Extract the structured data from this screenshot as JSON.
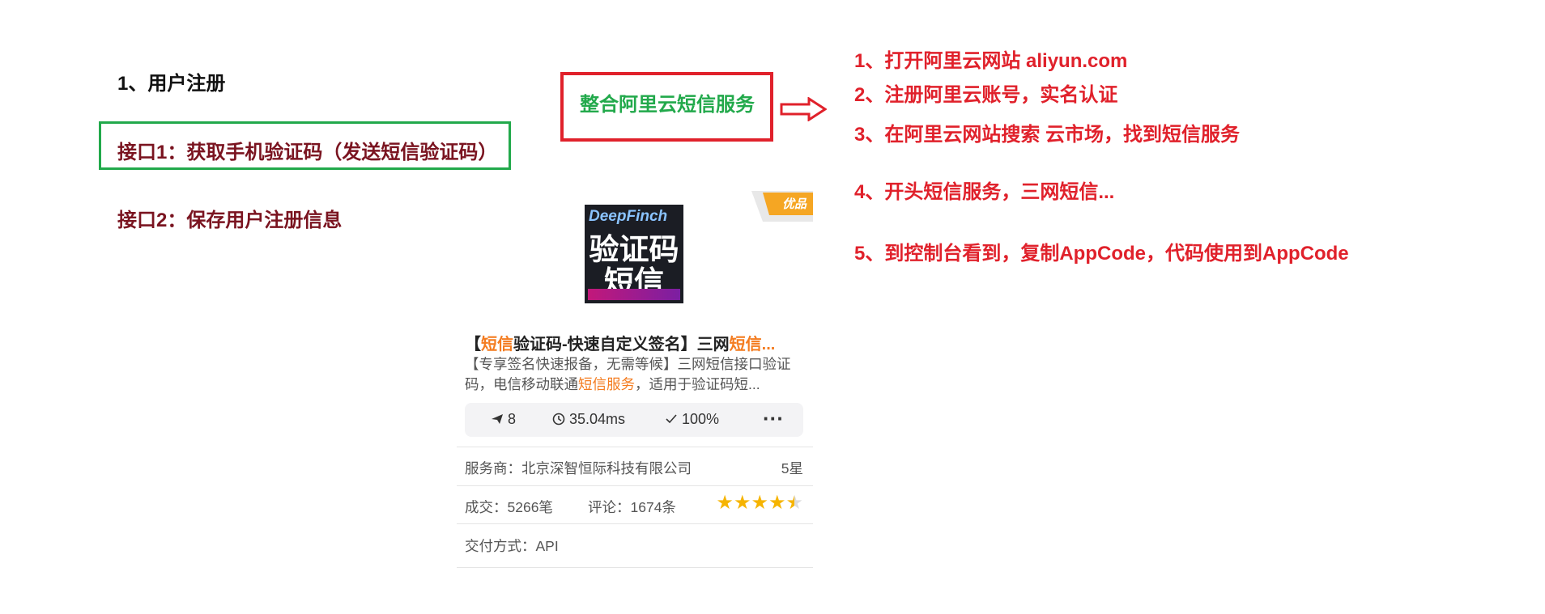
{
  "left": {
    "section_title": "1、用户注册",
    "api1": "接口1：获取手机验证码（发送短信验证码）",
    "api2": "接口2：保存用户注册信息"
  },
  "center": {
    "box_title": "整合阿里云短信服务"
  },
  "steps": [
    "1、打开阿里云网站 aliyun.com",
    "2、注册阿里云账号，实名认证",
    "3、在阿里云网站搜索 云市场，找到短信服务",
    "4、开头短信服务，三网短信...",
    "5、到控制台看到，复制AppCode，代码使用到AppCode"
  ],
  "product": {
    "badge": "优品",
    "thumb_logo": "DeepFinch",
    "thumb_line1": "验证码",
    "thumb_line2": "短信",
    "title_part1": "【",
    "title_highlight": "短信",
    "title_part2": "验证码-快速自定义签名】三网",
    "title_highlight2": "短信...",
    "desc_part1": "【专享签名快速报备，无需等候】三网短信接口验证码，电信移动联通",
    "desc_highlight": "短信服务",
    "desc_part2": "，适用于验证码短...",
    "stat_send": "8",
    "stat_time": "35.04ms",
    "stat_rate": "100%",
    "vendor": "服务商：北京深智恒际科技有限公司",
    "rating_text": "5星",
    "deals": "成交：5266笔",
    "comments": "评论：1674条",
    "rating_stars": 4.5,
    "delivery": "交付方式：API"
  },
  "colors": {
    "green": "#22a94b",
    "red": "#e0212b",
    "dark_red": "#7a1420",
    "orange": "#f47c20",
    "star": "#f6b400"
  }
}
